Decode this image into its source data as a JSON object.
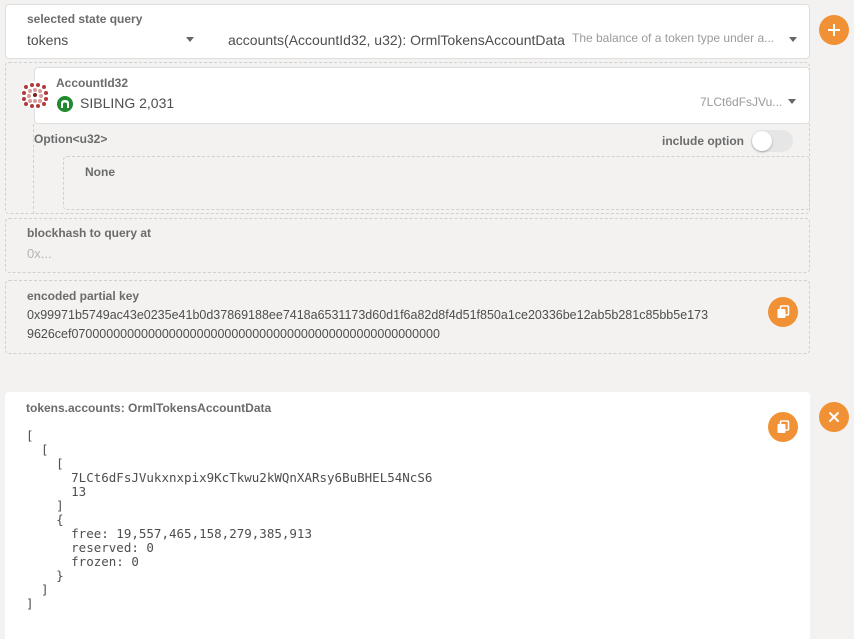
{
  "query": {
    "label": "selected state query",
    "module": "tokens",
    "method": "accounts(AccountId32, u32): OrmlTokensAccountData",
    "method_doc": "The balance of a token type under a..."
  },
  "account": {
    "label": "AccountId32",
    "name": "SIBLING 2,031",
    "address_short": "7LCt6dFsJVu..."
  },
  "option": {
    "label": "Option<u32>",
    "include_label": "include option",
    "include_enabled": false,
    "value": "None"
  },
  "blockhash": {
    "label": "blockhash to query at",
    "placeholder": "0x..."
  },
  "partial_key": {
    "label": "encoded partial key",
    "line1": "0x99971b5749ac43e0235e41b0d37869188ee7418a6531173d60d1f6a82d8f4d51f850a1ce20336be12ab5b281c85bb5e173",
    "line2": "9626cef07000000000000000000000000000000000000000000000000000"
  },
  "result": {
    "label": "tokens.accounts: OrmlTokensAccountData",
    "lines": [
      "[",
      "  [",
      "    [",
      "      7LCt6dFsJVukxnxpix9KcTkwu2kWQnXARsy6BuBHEL54NcS6",
      "      13",
      "    ]",
      "    {",
      "      free: 19,557,465,158,279,385,913",
      "      reserved: 0",
      "      frozen: 0",
      "    }",
      "  ]",
      "]"
    ]
  },
  "colors": {
    "accent": "#f19135",
    "identity_green": "#1f8a2e"
  },
  "icons": {
    "add": "plus-icon",
    "close": "close-icon",
    "copy": "copy-icon"
  }
}
